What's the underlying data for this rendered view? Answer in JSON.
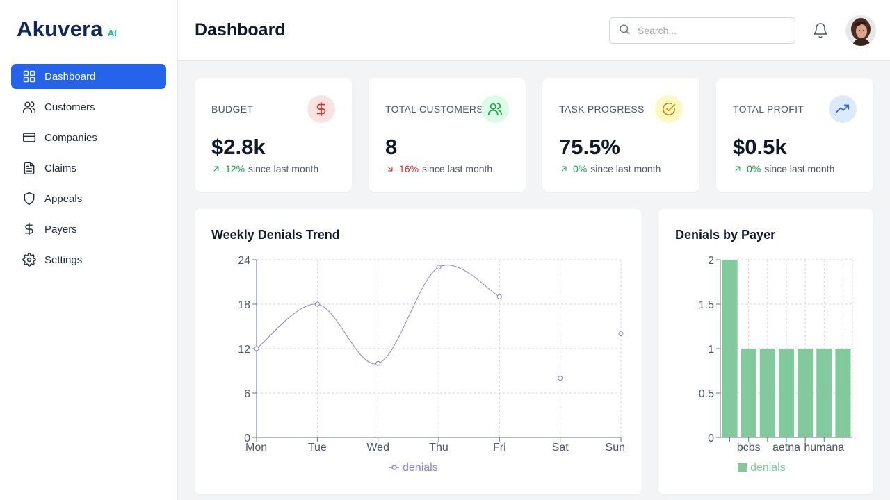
{
  "brand": {
    "name": "Akuvera",
    "suffix": "AI"
  },
  "sidebar": {
    "items": [
      {
        "label": "Dashboard",
        "icon": "grid-icon",
        "active": true
      },
      {
        "label": "Customers",
        "icon": "users-icon"
      },
      {
        "label": "Companies",
        "icon": "credit-card-icon"
      },
      {
        "label": "Claims",
        "icon": "file-text-icon"
      },
      {
        "label": "Appeals",
        "icon": "shield-icon"
      },
      {
        "label": "Payers",
        "icon": "dollar-sign-icon"
      },
      {
        "label": "Settings",
        "icon": "gear-icon"
      }
    ]
  },
  "header": {
    "title": "Dashboard",
    "search_placeholder": "Search...",
    "search_value": ""
  },
  "stats": [
    {
      "title": "BUDGET",
      "value": "$2.8k",
      "change": "12%",
      "direction": "up",
      "since": "since last month",
      "icon": "dollar-icon",
      "icon_color": "#dc2626",
      "icon_bg": "#fde2e2"
    },
    {
      "title": "TOTAL CUSTOMERS",
      "value": "8",
      "change": "16%",
      "direction": "down",
      "since": "since last month",
      "icon": "users-icon",
      "icon_color": "#16a34a",
      "icon_bg": "#dcfce7"
    },
    {
      "title": "TASK PROGRESS",
      "value": "75.5%",
      "change": "0%",
      "direction": "up",
      "since": "since last month",
      "icon": "check-circle-icon",
      "icon_color": "#ca8a04",
      "icon_bg": "#fef9c3"
    },
    {
      "title": "TOTAL PROFIT",
      "value": "$0.5k",
      "change": "0%",
      "direction": "up",
      "since": "since last month",
      "icon": "trending-up-icon",
      "icon_color": "#2563eb",
      "icon_bg": "#dbeafe"
    }
  ],
  "chart_data": [
    {
      "type": "line",
      "title": "Weekly Denials Trend",
      "categories": [
        "Mon",
        "Tue",
        "Wed",
        "Thu",
        "Fri",
        "Sat",
        "Sun"
      ],
      "series": [
        {
          "name": "denials",
          "values": [
            12,
            18,
            10,
            23,
            19,
            8,
            14
          ],
          "color": "#8884d8"
        }
      ],
      "ylim": [
        0,
        24
      ],
      "yticks": [
        "0",
        "6",
        "12",
        "18",
        "24"
      ],
      "grid": true,
      "legend": "bottom"
    },
    {
      "type": "bar",
      "title": "Denials by Payer",
      "categories": [
        "",
        "bcbs",
        "",
        "aetna",
        "",
        "humana",
        ""
      ],
      "series": [
        {
          "name": "denials",
          "values": [
            2,
            1,
            1,
            1,
            1,
            1,
            1
          ],
          "color": "#82ca9d"
        }
      ],
      "ylim": [
        0,
        2
      ],
      "yticks": [
        "0",
        "0.5",
        "1",
        "1.5",
        "2"
      ],
      "grid": true,
      "legend": "bottom"
    }
  ]
}
